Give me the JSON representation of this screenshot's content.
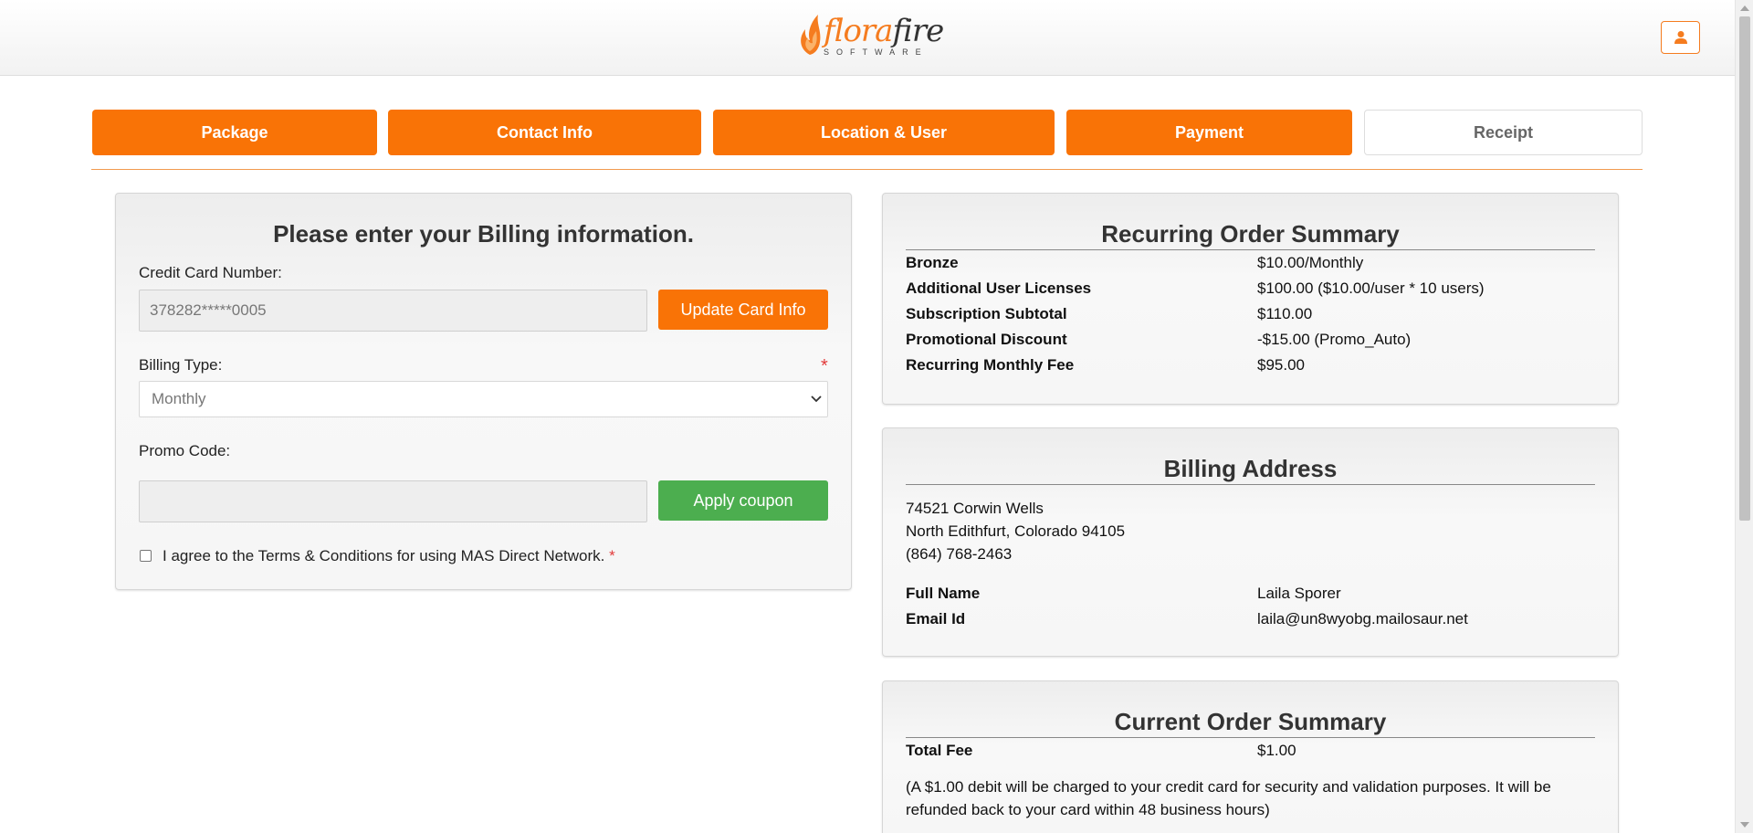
{
  "brand": {
    "name_part1": "flora",
    "name_part2": "fire",
    "tagline": "SOFTWARE"
  },
  "steps": [
    {
      "label": "Package"
    },
    {
      "label": "Contact Info"
    },
    {
      "label": "Location & User"
    },
    {
      "label": "Payment"
    },
    {
      "label": "Receipt"
    }
  ],
  "billing_form": {
    "title": "Please enter your Billing information.",
    "card_label": "Credit Card Number:",
    "card_value": "378282*****0005",
    "update_card_button": "Update Card Info",
    "billing_type_label": "Billing Type:",
    "required_mark": "*",
    "billing_type_value": "Monthly",
    "promo_label": "Promo Code:",
    "promo_value": "",
    "apply_coupon_button": "Apply coupon",
    "terms_text": "I agree to the Terms & Conditions for using MAS Direct Network.",
    "terms_checked": false
  },
  "recurring_summary": {
    "title": "Recurring Order Summary",
    "rows": [
      {
        "key": "Bronze",
        "value": "$10.00/Monthly"
      },
      {
        "key": "Additional User Licenses",
        "value": "$100.00 ($10.00/user * 10 users)"
      },
      {
        "key": "Subscription Subtotal",
        "value": "$110.00"
      },
      {
        "key": "Promotional Discount",
        "value": "-$15.00 (Promo_Auto)"
      },
      {
        "key": "Recurring Monthly Fee",
        "value": "$95.00"
      }
    ]
  },
  "billing_address": {
    "title": "Billing Address",
    "line1": "74521 Corwin Wells",
    "line2": "North Edithfurt, Colorado 94105",
    "phone": "(864) 768-2463",
    "full_name_label": "Full Name",
    "full_name": "Laila Sporer",
    "email_label": "Email Id",
    "email": "laila@un8wyobg.mailosaur.net"
  },
  "current_summary": {
    "title": "Current Order Summary",
    "total_label": "Total Fee",
    "total_value": "$1.00",
    "note_line1": "(A $1.00 debit will be charged to your credit card for security and validation purposes. It will be",
    "note_line2": "refunded back to your card within 48 business hours)"
  },
  "colors": {
    "accent": "#f97306",
    "success": "#4cae4f",
    "required": "#e23b3b"
  }
}
